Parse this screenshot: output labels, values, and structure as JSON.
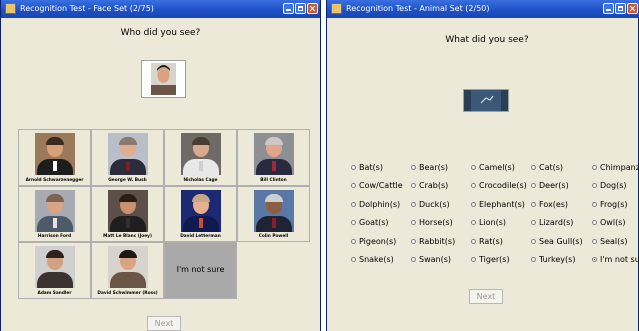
{
  "face_window": {
    "title": "Recognition Test - Face Set (2/75)",
    "question": "Who did you see?",
    "stimulus_icon": "face-photo",
    "options": [
      {
        "name": "Arnold Schwarzenegger",
        "skin": "#d7a07a",
        "hair": "#3b2a1e",
        "suit": "#1d1d1d",
        "tie": "#ffffff",
        "bg": "#9a7a5a"
      },
      {
        "name": "George W. Bush",
        "skin": "#e0ae8f",
        "hair": "#8a7a70",
        "suit": "#2b2e3a",
        "tie": "#7a1c2a",
        "bg": "#b9bfc9"
      },
      {
        "name": "Nicholas Cage",
        "skin": "#d9a98e",
        "hair": "#4a3c30",
        "suit": "#e8e8e8",
        "tie": "#cfcfcf",
        "bg": "#6f6a66"
      },
      {
        "name": "Bill Clinton",
        "skin": "#e2a48c",
        "hair": "#cfc8c2",
        "suit": "#2a2a3e",
        "tie": "#a0283a",
        "bg": "#8c8f94"
      },
      {
        "name": "Harrison Ford",
        "skin": "#d7a486",
        "hair": "#7c6450",
        "suit": "#4d5a6a",
        "tie": "#e2e2e2",
        "bg": "#a7aab0"
      },
      {
        "name": "Matt Le Blanc (Joey)",
        "skin": "#c99272",
        "hair": "#2a1d16",
        "suit": "#1f1f1f",
        "tie": "#2f2f2f",
        "bg": "#5b4f48"
      },
      {
        "name": "David Letterman",
        "skin": "#e8b092",
        "hair": "#c8a585",
        "suit": "#101a4e",
        "tie": "#d5482c",
        "bg": "#1b2a72"
      },
      {
        "name": "Colin Powell",
        "skin": "#8c5f44",
        "hair": "#cfcfcf",
        "suit": "#1f2434",
        "tie": "#8a1d2b",
        "bg": "#5a78a6"
      },
      {
        "name": "Adam Sandler",
        "skin": "#d2a083",
        "hair": "#2d2119",
        "suit": "#3a3330",
        "tie": "#3a3330",
        "bg": "#cfcfcf"
      },
      {
        "name": "David Schwimmer (Ross)",
        "skin": "#d9a383",
        "hair": "#1f1712",
        "suit": "#6b5546",
        "tie": "#6b5546",
        "bg": "#d8d3cc"
      }
    ],
    "not_sure_label": "I'm not sure",
    "next_label": "Next"
  },
  "animal_window": {
    "title": "Recognition Test - Animal Set (2/50)",
    "question": "What did you see?",
    "stimulus_icon": "animal-photo",
    "columns": [
      [
        "Bat(s)",
        "Cow/Cattle",
        "Dolphin(s)",
        "Goat(s)",
        "Pigeon(s)",
        "Snake(s)"
      ],
      [
        "Bear(s)",
        "Crab(s)",
        "Duck(s)",
        "Horse(s)",
        "Rabbit(s)",
        "Swan(s)"
      ],
      [
        "Camel(s)",
        "Crocodile(s)",
        "Elephant(s)",
        "Lion(s)",
        "Rat(s)",
        "Tiger(s)"
      ],
      [
        "Cat(s)",
        "Deer(s)",
        "Fox(es)",
        "Lizard(s)",
        "Sea Gull(s)",
        "Turkey(s)"
      ],
      [
        "Chimpanzee",
        "Dog(s)",
        "Frog(s)",
        "Owl(s)",
        "Seal(s)",
        "I'm not sure"
      ]
    ],
    "selected": "I'm not sure",
    "next_label": "Next"
  }
}
